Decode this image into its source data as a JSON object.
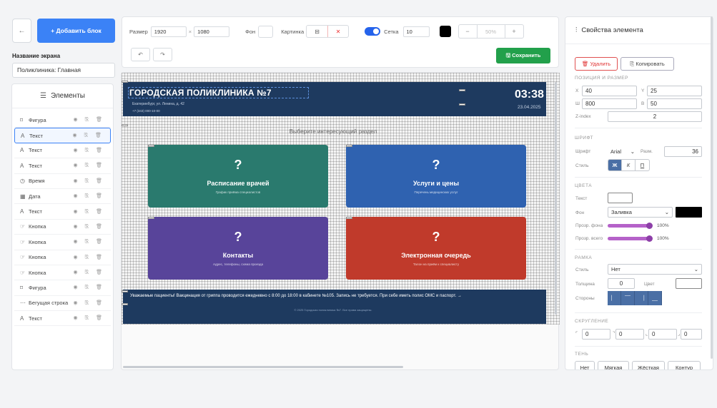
{
  "left": {
    "back_icon": "←",
    "add_block": "+ Добавить блок",
    "screen_name_label": "Название экрана",
    "screen_name_value": "Поликлиника: Главная",
    "elements_title": "Элементы",
    "elements": [
      {
        "icon": "⌑",
        "label": "Фигура",
        "selected": false,
        "acts": "◉ ⎘ 🗑"
      },
      {
        "icon": "A",
        "label": "Текст",
        "selected": true,
        "acts": "◉ ⎘ 🗑"
      },
      {
        "icon": "A",
        "label": "Текст",
        "selected": false,
        "acts": "◉ ⎘ 🗑"
      },
      {
        "icon": "A",
        "label": "Текст",
        "selected": false,
        "acts": "◉ ⎘ 🗑"
      },
      {
        "icon": "◷",
        "label": "Время",
        "selected": false,
        "acts": "◉ ⎘ 🗑"
      },
      {
        "icon": "▦",
        "label": "Дата",
        "selected": false,
        "acts": "◉ ⎘ 🗑"
      },
      {
        "icon": "A",
        "label": "Текст",
        "selected": false,
        "acts": "◉ ⎘ 🗑"
      },
      {
        "icon": "☞",
        "label": "Кнопка",
        "selected": false,
        "acts": "◉ ⎘ 🗑"
      },
      {
        "icon": "☞",
        "label": "Кнопка",
        "selected": false,
        "acts": "◉ ⎘ 🗑"
      },
      {
        "icon": "☞",
        "label": "Кнопка",
        "selected": false,
        "acts": "◉ ⎘ 🗑"
      },
      {
        "icon": "☞",
        "label": "Кнопка",
        "selected": false,
        "acts": "◉ ⎘ 🗑"
      },
      {
        "icon": "⌑",
        "label": "Фигура",
        "selected": false,
        "acts": "◉ ⎘ 🗑"
      },
      {
        "icon": "⋯",
        "label": "Бегущая строка",
        "selected": false,
        "acts": "◉ ⎘ 🗑"
      },
      {
        "icon": "A",
        "label": "Текст",
        "selected": false,
        "acts": "◉ ⎘ 🗑"
      }
    ]
  },
  "toolbar": {
    "size_label": "Размер",
    "width": "1920",
    "height": "1080",
    "times": "×",
    "bg_label": "Фон",
    "image_label": "Картинка",
    "grid_label": "Сетка",
    "grid_value": "10",
    "zoom_minus": "−",
    "zoom_value": "50%",
    "zoom_plus": "+",
    "undo": "↶",
    "redo": "↷",
    "save": "🖫 Сохранить"
  },
  "screen": {
    "title": "ГОРОДСКАЯ ПОЛИКЛИНИКА №7",
    "address": "Екатеринбург, ул. Ленина, д. 42",
    "phone": "+7 (343) 000-10-00",
    "time": "03:38",
    "date": "23.04.2025",
    "prompt": "Выберите интересующий раздел",
    "cards": [
      {
        "q": "?",
        "title": "Расписание врачей",
        "subtitle": "График приёма специалистов",
        "color": "#2a7a6e"
      },
      {
        "q": "?",
        "title": "Услуги и цены",
        "subtitle": "Перечень медицинских услуг",
        "color": "#2f62b0"
      },
      {
        "q": "?",
        "title": "Контакты",
        "subtitle": "Адрес, телефоны, схема проезда",
        "color": "#58449a"
      },
      {
        "q": "?",
        "title": "Электронная очередь",
        "subtitle": "Талон на приём к специалисту",
        "color": "#c03a2b"
      }
    ],
    "ticker": "Уважаемые пациенты! Вакцинация от гриппа проводится ежедневно с 8:00 до 18:00 в кабинете №105. Запись не требуется. При себе иметь полис ОМС и паспорт. →",
    "footer": "© 2025 Городская поликлиника №7. Все права защищены."
  },
  "props": {
    "title": "Свойства элемента",
    "delete": "🗑 Удалить",
    "copy": "⎘ Копировать",
    "pos_section": "ПОЗИЦИЯ И РАЗМЕР",
    "x_label": "X",
    "x": "40",
    "y_label": "Y",
    "y": "25",
    "w_label": "Ш",
    "w": "800",
    "h_label": "В",
    "h": "50",
    "z_label": "Z-index",
    "z": "2",
    "font_section": "ШРИФТ",
    "font_label": "Шрифт",
    "font": "Arial",
    "size_label": "Разм.",
    "size": "36",
    "style_label": "Стиль",
    "style_b": "Ж",
    "style_i": "К",
    "style_u": "П",
    "colors_section": "ЦВЕТА",
    "text_label": "Текст",
    "bg_label": "Фон",
    "bg_mode": "Заливка",
    "bg_opacity_label": "Прозр. фона",
    "bg_opacity": "100%",
    "all_opacity_label": "Прозр. всего",
    "all_opacity": "100%",
    "border_section": "РАМКА",
    "border_style_label": "Стиль",
    "border_style": "Нет",
    "thickness_label": "Толщина",
    "thickness": "0",
    "color_label": "Цвет",
    "sides_label": "Стороны",
    "radius_section": "СКРУГЛЕНИЕ",
    "radius": [
      "0",
      "0",
      "0",
      "0"
    ],
    "shadow_section": "ТЕНЬ",
    "shadows": [
      "Нет",
      "Мягкая",
      "Жёсткая",
      "Контур"
    ]
  }
}
